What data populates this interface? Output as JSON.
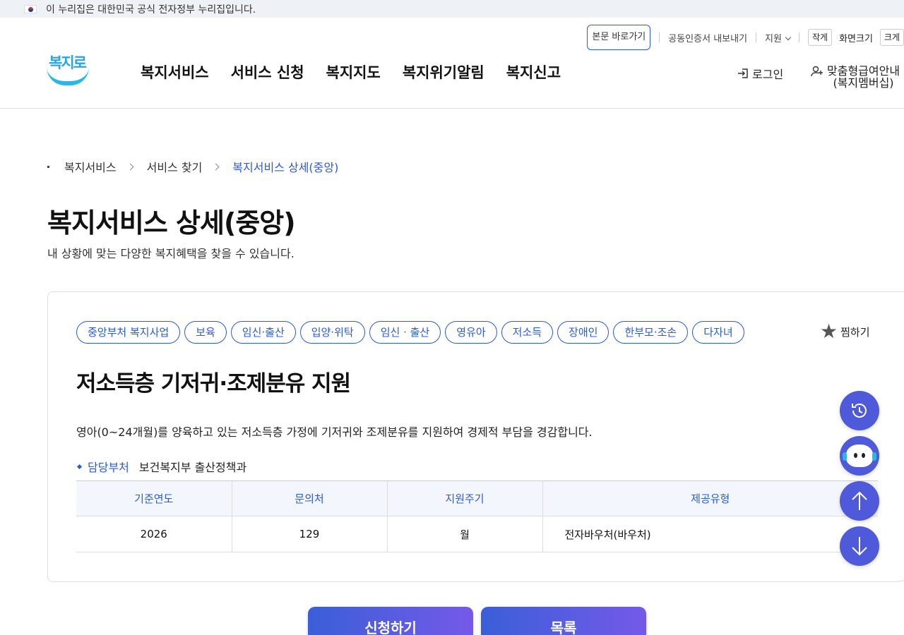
{
  "gov_banner": {
    "text": "이 누리집은 대한민국 공식 전자정부 누리집입니다."
  },
  "utility": {
    "skip_link": "본문 바로가기",
    "cert_export": "공동인증서 내보내기",
    "support": "지원",
    "font_small": "작게",
    "font_size_label": "화면크기",
    "font_large": "크게"
  },
  "header": {
    "logo_text": "복지로",
    "nav": [
      "복지서비스",
      "서비스 신청",
      "복지지도",
      "복지위기알림",
      "복지신고"
    ],
    "login": "로그인",
    "member_line1": "맞춤형급여안내",
    "member_line2": "(복지멤버십)"
  },
  "breadcrumb": {
    "items": [
      "복지서비스",
      "서비스 찾기"
    ],
    "current": "복지서비스 상세(중앙)"
  },
  "page": {
    "title": "복지서비스 상세(중앙)",
    "description": "내 상황에 맞는 다양한 복지혜택을 찾을 수 있습니다."
  },
  "service": {
    "tags": [
      "중앙부처 복지사업",
      "보육",
      "임신·출산",
      "입양·위탁",
      "임신 · 출산",
      "영유아",
      "저소득",
      "장애인",
      "한부모·조손",
      "다자녀"
    ],
    "favorite": "찜하기",
    "title": "저소득층 기저귀·조제분유 지원",
    "description": "영아(0~24개월)를 양육하고 있는 저소득층 가정에 기저귀와 조제분유를 지원하여 경제적 부담을 경감합니다.",
    "dept_label": "담당부처",
    "dept_value": "보건복지부 출산정책과",
    "table": {
      "headers": [
        "기준연도",
        "문의처",
        "지원주기",
        "제공유형"
      ],
      "row": [
        "2026",
        "129",
        "월",
        "전자바우처(바우처)"
      ]
    }
  },
  "floating": [
    "history-icon",
    "chatbot-icon",
    "scroll-top-icon",
    "scroll-bottom-icon"
  ],
  "actions": {
    "apply": "신청하기",
    "list": "목록"
  },
  "colors": {
    "accent": "#2c5bd6",
    "fab": "#4e5ad9"
  }
}
